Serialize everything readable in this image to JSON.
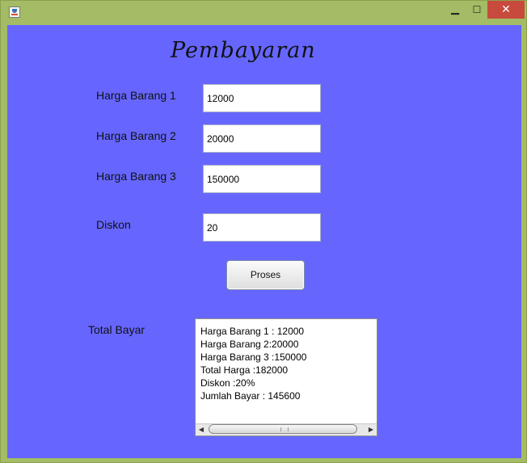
{
  "window": {
    "minimize_glyph": "▁",
    "maximize_glyph": "☐",
    "close_glyph": "✕",
    "icon": "java-app-icon",
    "colors": {
      "frame": "#a3bc65",
      "client": "#6666ff",
      "close": "#c74a3d"
    }
  },
  "form": {
    "title": "Pembayaran",
    "fields": [
      {
        "label": "Harga Barang 1",
        "value": "12000"
      },
      {
        "label": "Harga Barang 2",
        "value": "20000"
      },
      {
        "label": "Harga Barang 3",
        "value": "150000"
      },
      {
        "label": "Diskon",
        "value": "20"
      }
    ],
    "process_label": "Proses",
    "total_label": "Total Bayar",
    "output_lines": [
      "Harga Barang 1 : 12000",
      "Harga Barang 2:20000",
      "Harga Barang 3 :150000",
      "Total Harga :182000",
      "Diskon :20%",
      "Jumlah Bayar : 145600"
    ],
    "scroll_left_glyph": "◀",
    "scroll_right_glyph": "▶"
  }
}
